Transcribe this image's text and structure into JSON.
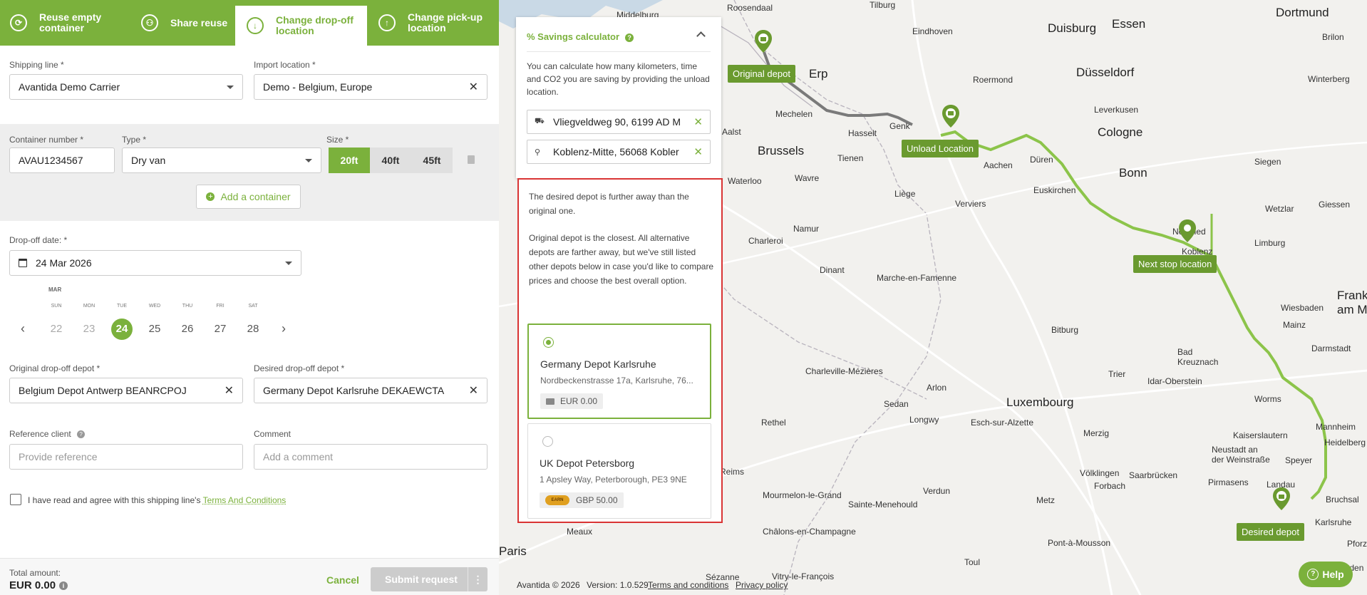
{
  "tabs": [
    {
      "label": "Reuse empty container",
      "icon": "recycle-icon",
      "active": false
    },
    {
      "label": "Share reuse",
      "icon": "people-icon",
      "active": false
    },
    {
      "label": "Change drop-off location",
      "icon": "arrow-down-icon",
      "active": true
    },
    {
      "label": "Change pick-up location",
      "icon": "arrow-up-icon",
      "active": false
    }
  ],
  "form": {
    "shipping_line_label": "Shipping line *",
    "shipping_line_value": "Avantida Demo Carrier",
    "import_location_label": "Import location *",
    "import_location_value": "Demo - Belgium, Europe",
    "container_number_label": "Container number *",
    "container_number_value": "AVAU1234567",
    "type_label": "Type *",
    "type_value": "Dry van",
    "size_label": "Size *",
    "sizes": [
      "20ft",
      "40ft",
      "45ft"
    ],
    "size_selected": "20ft",
    "add_container_label": "Add a container",
    "dropoff_date_label": "Drop-off date: *",
    "dropoff_date_value": "24 Mar 2026",
    "original_depot_label": "Original drop-off depot *",
    "original_depot_value": "Belgium Depot Antwerp BEANRCPOJ",
    "desired_depot_label": "Desired drop-off depot *",
    "desired_depot_value": "Germany Depot Karlsruhe DEKAEWCTA",
    "reference_label": "Reference client",
    "reference_placeholder": "Provide reference",
    "comment_label": "Comment",
    "comment_placeholder": "Add a comment",
    "terms_text": "I have read and agree with this shipping line's",
    "terms_link": "Terms And Conditions"
  },
  "calendar": {
    "month": "MAR",
    "weekdays": [
      "SUN",
      "MON",
      "TUE",
      "WED",
      "THU",
      "FRI",
      "SAT"
    ],
    "days": [
      "22",
      "23",
      "24",
      "25",
      "26",
      "27",
      "28"
    ],
    "selected": "24"
  },
  "footer": {
    "total_label": "Total amount:",
    "total_value": "EUR 0.00",
    "cancel_label": "Cancel",
    "submit_label": "Submit request",
    "more_label": "⋮"
  },
  "calc": {
    "title": "% Savings calculator",
    "description": "You can calculate how many kilometers, time and CO2 you are saving by providing the unload location.",
    "unload_address": "Vliegveldweg 90, 6199 AD M",
    "next_stop_address": "Koblenz-Mitte, 56068 Kobler"
  },
  "alternatives": {
    "message_1": "The desired depot is further away than the original one.",
    "message_2": "Original depot is the closest. All alternative depots are farther away, but we've still listed other depots below in case you'd like to compare prices and choose the best overall option.",
    "cards": [
      {
        "name": "Germany Depot Karlsruhe",
        "address": "Nordbeckenstrasse 17a, Karlsruhe, 76...",
        "price": "EUR 0.00",
        "selected": true,
        "earn": false
      },
      {
        "name": "UK Depot Petersborg",
        "address": "1 Apsley Way, Peterborough, PE3 9NE",
        "price": "GBP 50.00",
        "selected": false,
        "earn": true
      }
    ],
    "earn_badge": "EARN"
  },
  "map": {
    "markers": [
      "Original depot",
      "Unload Location",
      "Next stop location",
      "Desired depot"
    ],
    "cities": [
      "Middelburg",
      "Roosendaal",
      "Tilburg",
      "Eindhoven",
      "Duisburg",
      "Essen",
      "Dortmund",
      "Düsseldorf",
      "Roermond",
      "Mechelen",
      "Hasselt",
      "Genk",
      "Cologne",
      "Leverkusen",
      "Aalst",
      "Brussels",
      "Aachen",
      "Düren",
      "Bonn",
      "Tienen",
      "Waterloo",
      "Wavre",
      "Liège",
      "Verviers",
      "Euskirchen",
      "Namur",
      "Charleroi",
      "Neuwied",
      "Koblenz",
      "Limburg",
      "Dinant",
      "Marche-en-Famenne",
      "Wiesbaden",
      "Mainz",
      "Frankfurt am Main",
      "Bitburg",
      "Bad Kreuznach",
      "Darmstadt",
      "Trier",
      "Idar-Oberstein",
      "Charleville-Mézières",
      "Arlon",
      "Sedan",
      "Luxembourg",
      "Worms",
      "Mannheim",
      "Rethel",
      "Longwy",
      "Esch-sur-Alzette",
      "Merzig",
      "Kaiserslautern",
      "Neustadt an der Weinstraße",
      "Heidelberg",
      "Speyer",
      "Reims",
      "Saarbrücken",
      "Völklingen",
      "Forbach",
      "Pirmasens",
      "Landau",
      "Verdun",
      "Metz",
      "Bruchsal",
      "Mourmelon-le-Grand",
      "Sainte-Menehould",
      "Karlsruhe",
      "Meaux",
      "Châlons-en-Champagne",
      "Paris",
      "Pont-à-Mousson",
      "Toul",
      "Baden-Baden",
      "Pforzheim",
      "Sézanne",
      "Vitry-le-François",
      "Brilon",
      "Winterberg",
      "Siegen",
      "Wetzlar",
      "Giessen",
      "Erp"
    ],
    "help_label": "Help",
    "copyright": "Avantida © 2026",
    "version": "Version: 1.0.529",
    "terms_link": "Terms and conditions",
    "privacy_link": "Privacy policy"
  },
  "colors": {
    "accent": "#7bb13c",
    "marker": "#6a9a2f",
    "highlight_border": "#d93434"
  }
}
